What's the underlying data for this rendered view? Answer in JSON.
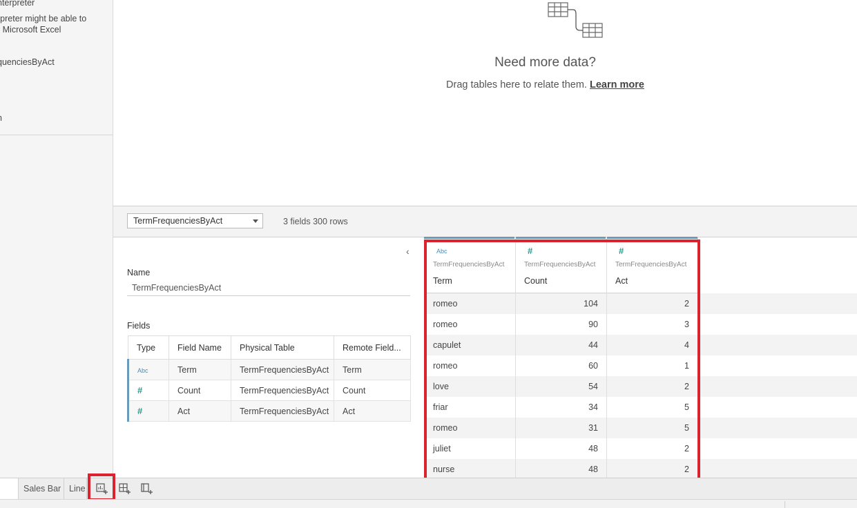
{
  "left_pane": {
    "lines": [
      "nterpreter",
      "rpreter might be able to",
      "r Microsoft Excel",
      ".",
      "quenciesByAct",
      "n"
    ]
  },
  "canvas": {
    "heading": "Need more data?",
    "drag_text": "Drag tables here to relate them.",
    "learn_more": "Learn more"
  },
  "table_bar": {
    "selected_table": "TermFrequenciesByAct",
    "summary": "3 fields 300 rows"
  },
  "metadata": {
    "name_label": "Name",
    "name_value": "TermFrequenciesByAct",
    "fields_label": "Fields",
    "columns": [
      "Type",
      "Field Name",
      "Physical Table",
      "Remote Field..."
    ],
    "rows": [
      {
        "type": "Abc",
        "field": "Term",
        "table": "TermFrequenciesByAct",
        "remote": "Term"
      },
      {
        "type": "#",
        "field": "Count",
        "table": "TermFrequenciesByAct",
        "remote": "Count"
      },
      {
        "type": "#",
        "field": "Act",
        "table": "TermFrequenciesByAct",
        "remote": "Act"
      }
    ]
  },
  "grid": {
    "columns": [
      {
        "type": "Abc",
        "table": "TermFrequenciesByAct",
        "name": "Term"
      },
      {
        "type": "#",
        "table": "TermFrequenciesByAct",
        "name": "Count"
      },
      {
        "type": "#",
        "table": "TermFrequenciesByAct",
        "name": "Act"
      }
    ],
    "rows": [
      [
        "romeo",
        "104",
        "2"
      ],
      [
        "romeo",
        "90",
        "3"
      ],
      [
        "capulet",
        "44",
        "4"
      ],
      [
        "romeo",
        "60",
        "1"
      ],
      [
        "love",
        "54",
        "2"
      ],
      [
        "friar",
        "34",
        "5"
      ],
      [
        "romeo",
        "31",
        "5"
      ],
      [
        "juliet",
        "48",
        "2"
      ],
      [
        "nurse",
        "48",
        "2"
      ]
    ]
  },
  "tabs": {
    "items": [
      "Sales Bar",
      "Line"
    ],
    "icons": [
      "new-worksheet-icon",
      "new-dashboard-icon",
      "new-story-icon"
    ]
  },
  "colors": {
    "highlight": "#d9232e",
    "field_accent": "#6a9ab9",
    "number_type": "#2b9a8e",
    "string_type": "#4a8db5"
  }
}
